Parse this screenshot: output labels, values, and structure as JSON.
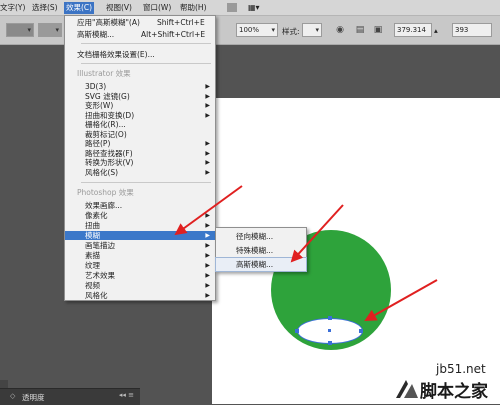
{
  "menubar": {
    "items": [
      "文字(Y)",
      "选择(S)",
      "效果(C)",
      "视图(V)",
      "窗口(W)",
      "帮助(H)"
    ]
  },
  "controlbar": {
    "zoom": "100%",
    "style_label": "样式:",
    "x_value": "379.314",
    "y_value": "393"
  },
  "effect_menu": {
    "apply_last": {
      "label": "应用\"高斯模糊\"(A)",
      "shortcut": "Shift+Ctrl+E"
    },
    "last_effect": {
      "label": "高斯模糊...",
      "shortcut": "Alt+Shift+Ctrl+E"
    },
    "doc_raster": "文档栅格效果设置(E)...",
    "illustrator_header": "Illustrator 效果",
    "illustrator_items": [
      "3D(3)",
      "SVG 滤镜(G)",
      "变形(W)",
      "扭曲和变换(D)",
      "栅格化(R)...",
      "裁剪标记(O)",
      "路径(P)",
      "路径查找器(F)",
      "转换为形状(V)",
      "风格化(S)"
    ],
    "photoshop_header": "Photoshop 效果",
    "photoshop_items": [
      "效果画廊...",
      "像素化",
      "扭曲",
      "模糊",
      "画笔描边",
      "素描",
      "纹理",
      "艺术效果",
      "视频",
      "风格化"
    ]
  },
  "blur_submenu": {
    "items": [
      "径向模糊...",
      "特殊模糊...",
      "高斯模糊..."
    ]
  },
  "panel": {
    "tab_label": "透明度"
  },
  "watermark": {
    "line1": "jb51.net",
    "line2": "脚本之家"
  },
  "colors": {
    "circle": "#2ea33b",
    "highlight": "#3c78c9",
    "arrow": "#e02020",
    "selection": "#3b6fd8"
  }
}
